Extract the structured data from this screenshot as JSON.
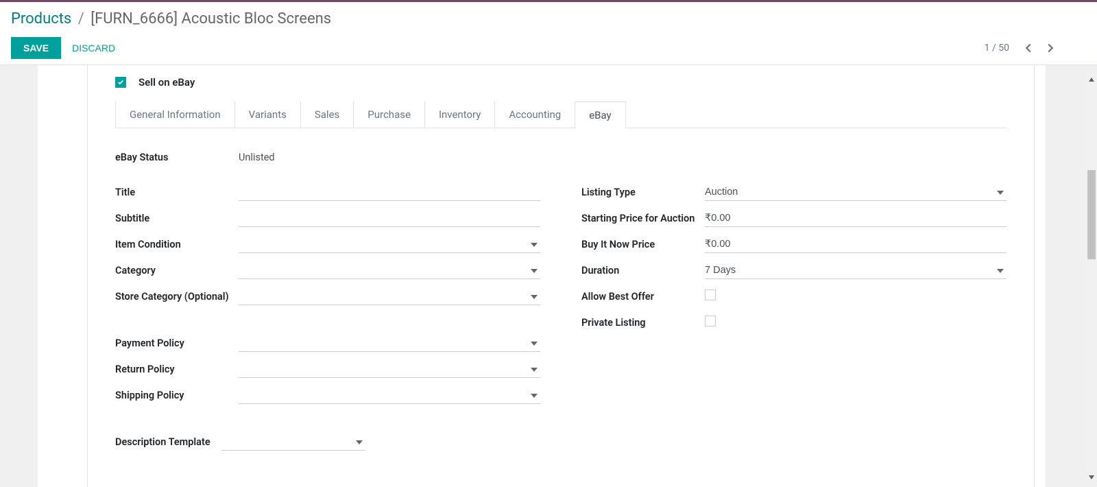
{
  "breadcrumb": {
    "root": "Products",
    "current": "[FURN_6666] Acoustic Bloc Screens"
  },
  "actions": {
    "save": "SAVE",
    "discard": "DISCARD"
  },
  "pager": {
    "text": "1 / 50"
  },
  "sell_ebay": {
    "label": "Sell on eBay",
    "checked": true
  },
  "tabs": [
    {
      "label": "General Information",
      "active": false
    },
    {
      "label": "Variants",
      "active": false
    },
    {
      "label": "Sales",
      "active": false
    },
    {
      "label": "Purchase",
      "active": false
    },
    {
      "label": "Inventory",
      "active": false
    },
    {
      "label": "Accounting",
      "active": false
    },
    {
      "label": "eBay",
      "active": true
    }
  ],
  "form": {
    "ebay_status_label": "eBay Status",
    "ebay_status_value": "Unlisted",
    "title_label": "Title",
    "title_value": "",
    "subtitle_label": "Subtitle",
    "subtitle_value": "",
    "item_condition_label": "Item Condition",
    "item_condition_value": "",
    "category_label": "Category",
    "category_value": "",
    "store_category_label": "Store Category (Optional)",
    "store_category_value": "",
    "payment_policy_label": "Payment Policy",
    "payment_policy_value": "",
    "return_policy_label": "Return Policy",
    "return_policy_value": "",
    "shipping_policy_label": "Shipping Policy",
    "shipping_policy_value": "",
    "description_template_label": "Description Template",
    "description_template_value": "",
    "listing_type_label": "Listing Type",
    "listing_type_value": "Auction",
    "starting_price_label": "Starting Price for Auction",
    "starting_price_value": "₹0.00",
    "buy_now_label": "Buy It Now Price",
    "buy_now_value": "₹0.00",
    "duration_label": "Duration",
    "duration_value": "7 Days",
    "allow_best_offer_label": "Allow Best Offer",
    "allow_best_offer_checked": false,
    "private_listing_label": "Private Listing",
    "private_listing_checked": false
  }
}
